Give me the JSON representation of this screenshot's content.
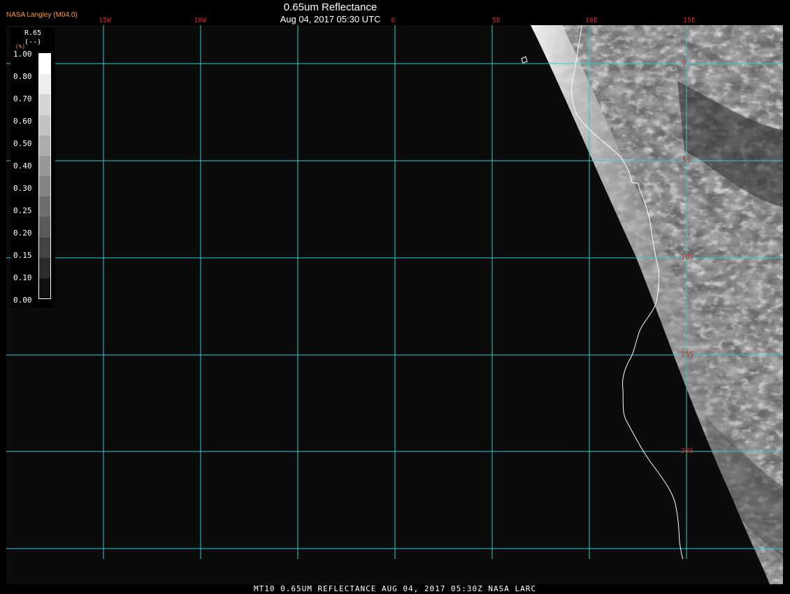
{
  "header": {
    "credit": "NASA Langley (M04.0)",
    "title": "0.65um Reflectance",
    "datetime": "Aug 04, 2017 05:30 UTC"
  },
  "map": {
    "lon_labels": [
      "15W",
      "10W",
      "5W",
      "0",
      "5E",
      "10E",
      "15E"
    ],
    "lat_labels": [
      "0",
      "5S",
      "10S",
      "15S",
      "20S"
    ],
    "colors": {
      "grid": "#2fc8d4",
      "label": "#d82020",
      "coastline": "#ffffff",
      "ocean": "#0b0b0b"
    }
  },
  "legend": {
    "title": "R.65",
    "unit": "(--)",
    "unit_prefix": "(%)",
    "ticks": [
      "1.00",
      "0.80",
      "0.70",
      "0.60",
      "0.50",
      "0.40",
      "0.30",
      "0.25",
      "0.20",
      "0.15",
      "0.10",
      "0.00"
    ],
    "colors": [
      "#ffffff",
      "#eeeeee",
      "#d6d6d6",
      "#c2c2c2",
      "#adadad",
      "#989898",
      "#838383",
      "#6e6e6e",
      "#5a5a5a",
      "#444444",
      "#2c2c2c",
      "#111111"
    ]
  },
  "footer": {
    "text": "MT10  0.65UM REFLECTANCE   AUG 04, 2017 05:30Z   NASA LARC"
  }
}
